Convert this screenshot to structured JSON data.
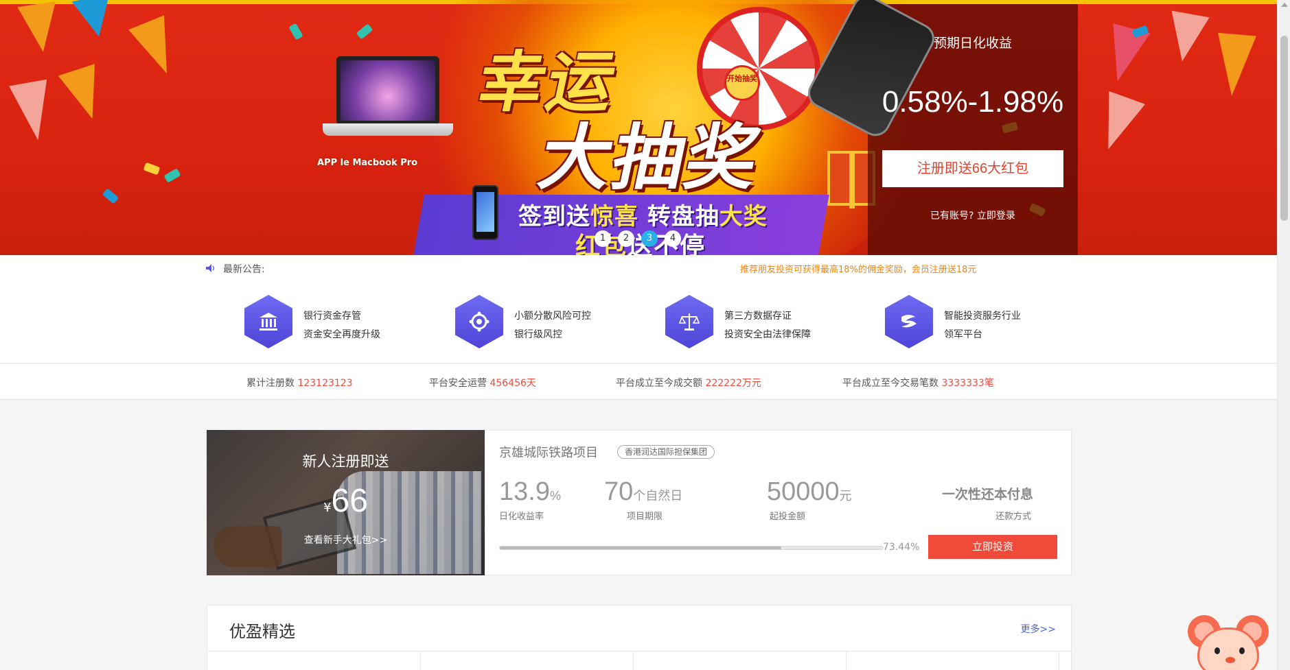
{
  "banner": {
    "laptop_caption": "APP le Macbook Pro",
    "title_line1": "幸运",
    "title_line2": "大抽奖",
    "wheel_center": "开始抽奖",
    "slogan1_a": "签到送",
    "slogan1_b": "惊喜",
    "slogan1_c": " 转盘抽",
    "slogan1_d": "大奖",
    "slogan2_a": "红包",
    "slogan2_b": "送不停",
    "slides": [
      "1",
      "2",
      "3",
      "4"
    ],
    "active_slide": 3
  },
  "side_panel": {
    "title": "预期日化收益",
    "rate": "0.58%-1.98%",
    "register_button": "注册即送66大红包",
    "login_link": "已有账号? 立即登录"
  },
  "notice": {
    "label": "最新公告:",
    "text": "推荐朋友投资可获得最高18%的佣金奖励，会员注册送18元"
  },
  "features": [
    {
      "icon": "bank-icon",
      "line1": "银行资金存管",
      "line2": "资金安全再度升级"
    },
    {
      "icon": "gear-icon",
      "line1": "小额分散风险可控",
      "line2": "银行级风控"
    },
    {
      "icon": "scale-icon",
      "line1": "第三方数据存证",
      "line2": "投资安全由法律保障"
    },
    {
      "icon": "logo-icon",
      "line1": "智能投资服务行业",
      "line2": "领军平台"
    }
  ],
  "stats": [
    {
      "label": "累计注册数",
      "value": "123123123"
    },
    {
      "label": "平台安全运营",
      "value": "456456天"
    },
    {
      "label": "平台成立至今成交额",
      "value": "222222万元"
    },
    {
      "label": "平台成立至今交易笔数",
      "value": "3333333笔"
    }
  ],
  "promo": {
    "title": "新人注册即送",
    "currency": "¥",
    "amount": "66",
    "link": "查看新手大礼包>>"
  },
  "product": {
    "name": "京雄城际铁路项目",
    "tag": "香港润达国际担保集团",
    "rate_value": "13.9",
    "rate_unit": "%",
    "rate_label": "日化收益率",
    "term_value": "70",
    "term_unit": "个自然日",
    "term_label": "项目期限",
    "min_value": "50000",
    "min_unit": "元",
    "min_label": "起投金额",
    "repay_value": "一次性还本付息",
    "repay_label": "还款方式",
    "progress": 73.44,
    "progress_label": "73.44%",
    "invest_button": "立即投资"
  },
  "section": {
    "title": "优盈精选",
    "more": "更多>>"
  },
  "colors": {
    "accent_red": "#f04a3a",
    "hex_purple": "#5a52e0",
    "notice_orange": "#f0850f"
  }
}
